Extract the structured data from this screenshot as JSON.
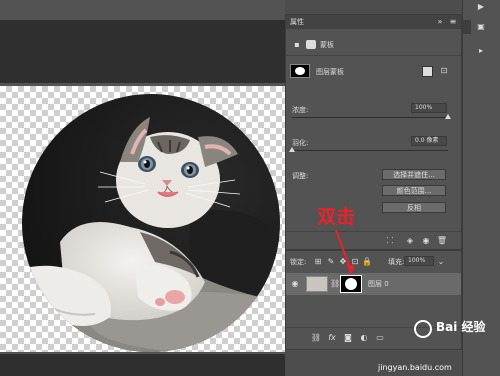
{
  "properties_panel": {
    "title": "属性",
    "subheader": "蒙板",
    "mask_name": "图层蒙板",
    "density_label": "浓度:",
    "density_value": "100%",
    "density_level": 1.0,
    "feather_label": "羽化:",
    "feather_value": "0.0 像素",
    "feather_level": 0.0,
    "refine_label": "调整:",
    "btn_select_mask": "选择并遮住...",
    "btn_color_range": "颜色范围...",
    "btn_invert": "反相"
  },
  "layers_panel": {
    "lock_label": "锁定:",
    "fill_label": "填充:",
    "fill_value": "100%",
    "layer_name": "图层 0",
    "footer_icons": [
      "link-icon",
      "fx-icon",
      "mask-icon",
      "adjustment-icon",
      "folder-icon",
      "new-layer-icon",
      "trash-icon"
    ]
  },
  "annotation": {
    "text": "双击",
    "color": "#e8232b"
  },
  "watermark": {
    "brand": "Bai 经验",
    "url": "jingyan.baidu.com"
  },
  "colors": {
    "panel_bg": "#535353",
    "canvas_dark": "#2f2f2f",
    "accent_red": "#e8232b"
  }
}
